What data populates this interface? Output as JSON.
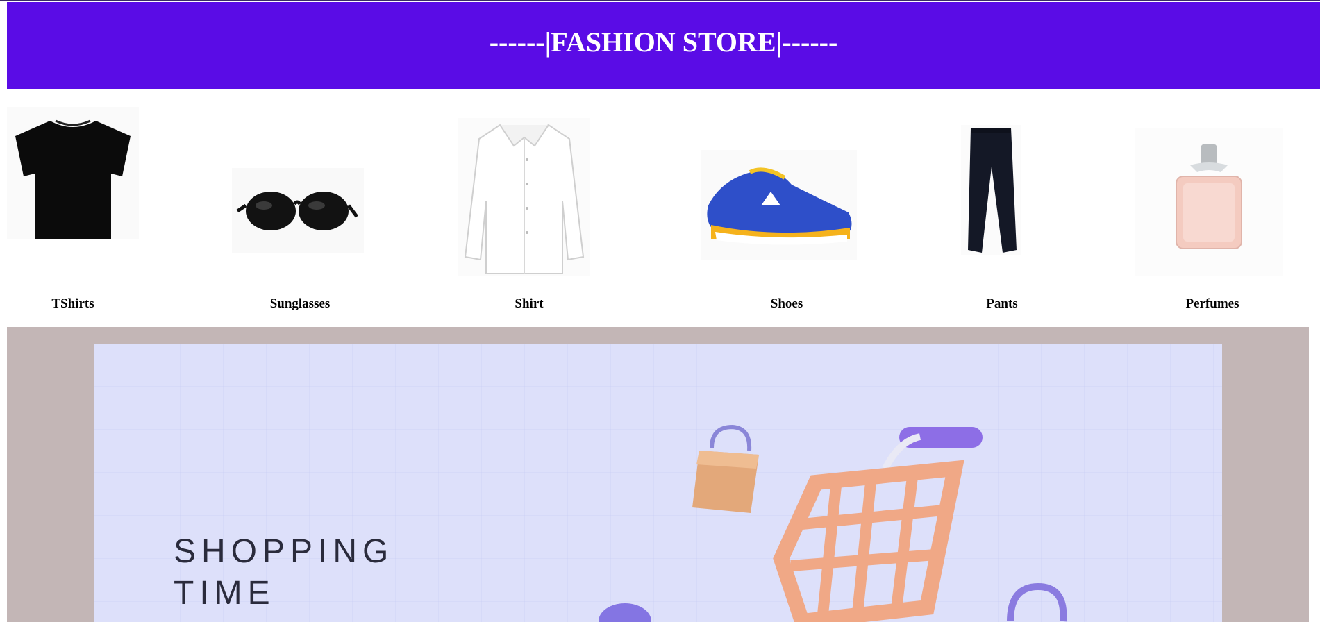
{
  "header": {
    "title": "------|FASHION STORE|------"
  },
  "products": [
    {
      "label": "TShirts",
      "icon": "tshirt-icon"
    },
    {
      "label": "Sunglasses",
      "icon": "sunglasses-icon"
    },
    {
      "label": "Shirt",
      "icon": "shirt-icon"
    },
    {
      "label": "Shoes",
      "icon": "shoe-icon"
    },
    {
      "label": "Pants",
      "icon": "pants-icon"
    },
    {
      "label": "Perfumes",
      "icon": "perfume-icon"
    }
  ],
  "banner": {
    "line1": "SHOPPING",
    "line2": "TIME"
  },
  "colors": {
    "header_bg": "#5a0ce6",
    "banner_frame": "#c3b6b6",
    "banner_bg": "#dde0fa"
  }
}
